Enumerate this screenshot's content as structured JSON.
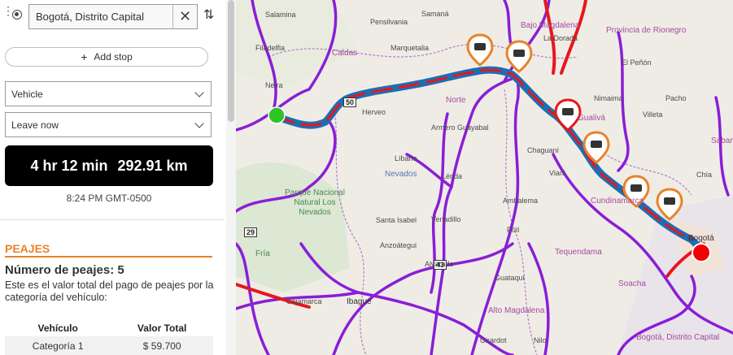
{
  "route_panel": {
    "origin_value": "Bogotá, Distrito Capital",
    "add_stop_label": "Add stop",
    "vehicle_select": "Vehicle",
    "departure_select": "Leave now",
    "summary": {
      "duration": "4 hr 12 min",
      "distance": "292.91 km"
    },
    "arrival_time": "8:24 PM GMT-0500"
  },
  "tolls": {
    "section_title": "PEAJES",
    "count_text": "Número de peajes: 5",
    "description": "Este es el valor total del pago de peajes por la categoría del vehículo:",
    "table": {
      "headers": [
        "Vehículo",
        "Valor Total"
      ],
      "rows": [
        [
          "Categoría 1",
          "$ 59.700"
        ]
      ]
    }
  },
  "map": {
    "route_colors": {
      "route": "#1a6fb5",
      "traffic_red": "#e8161d",
      "road_purple": "#8a1ed6"
    },
    "start_marker_color": "#2ec524",
    "end_marker_color": "#f40000",
    "toll_pin_icon": "toll-truck-icon",
    "labels": [
      "Salamina",
      "Pensilvania",
      "Samaná",
      "Bajo Magdalena",
      "Provincia de Rionegro",
      "Filadelfia",
      "Caldas",
      "Marquetalia",
      "La Dorada",
      "El Peñón",
      "Neira",
      "Nimaima",
      "Pacho",
      "Herveo",
      "Norte",
      "Armero Guayabal",
      "Gualivá",
      "Chaguaní",
      "Villeta",
      "Líbano",
      "Viani",
      "Nevados",
      "Lérida",
      "Parque Nacional Natural Los Nevados",
      "Ambalema",
      "Cundinamarca",
      "Santa Isabel",
      "Venadillo",
      "Tequendama",
      "Anzoátegui",
      "Pulí",
      "Fría",
      "Alvarado",
      "Guataquí",
      "Soacha",
      "Ibagué",
      "Cajamarca",
      "Alto Magdalena",
      "Girardot",
      "Nilo",
      "Bogotá, Distrito Capital",
      "Bogotá",
      "Chía",
      "Sabana"
    ],
    "road_shields": [
      "50",
      "29",
      "43"
    ]
  }
}
